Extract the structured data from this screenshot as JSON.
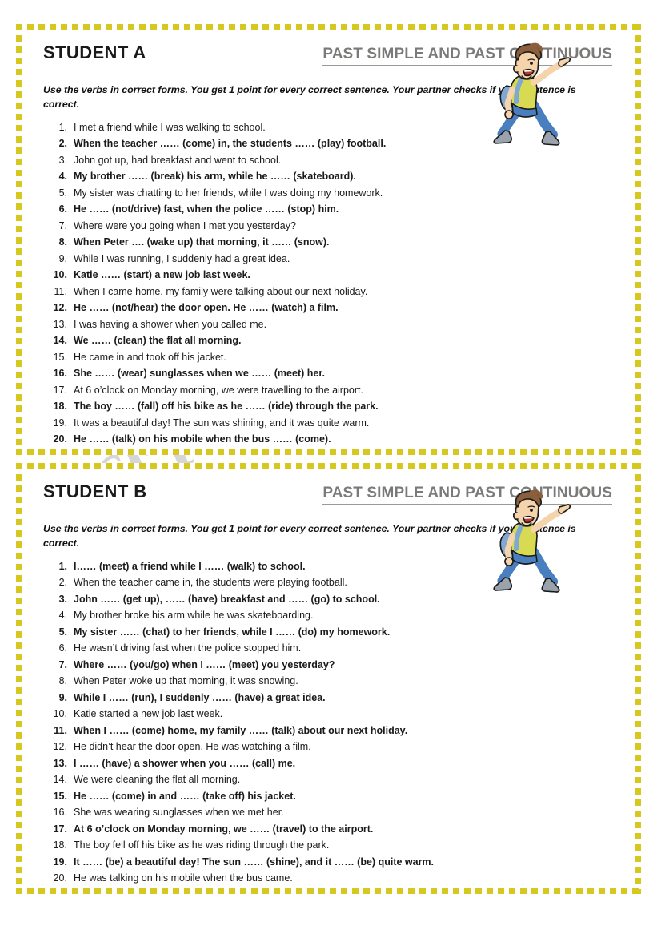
{
  "watermark": {
    "text": "esl-printables.com"
  },
  "colors": {
    "border_yellow": "#d6c81e",
    "title_gray": "#7a7a78",
    "text_black": "#1a1a1a",
    "shirt_yellow": "#d8db52",
    "jeans_blue": "#4a7fbf",
    "backpack_blue": "#7fa8d4",
    "hair_brown": "#8b5e3c",
    "skin": "#f5d3ab",
    "shoe_gray": "#9aa3ad"
  },
  "sections": [
    {
      "student_label": "STUDENT A",
      "topic_title": "PAST SIMPLE AND PAST CONTINUOUS",
      "instructions": "Use the verbs in correct forms.  You get 1 point for every correct sentence.  Your partner checks if your sentence is correct.",
      "illustration": "running-schoolboy",
      "sentences": [
        {
          "n": 1,
          "gap": false,
          "text": "I met a friend while I was walking to school."
        },
        {
          "n": 2,
          "gap": true,
          "text": "When the teacher …… (come) in, the students …… (play) football."
        },
        {
          "n": 3,
          "gap": false,
          "text": "John got up, had breakfast and went to school."
        },
        {
          "n": 4,
          "gap": true,
          "text": "My brother …… (break) his arm, while he …… (skateboard)."
        },
        {
          "n": 5,
          "gap": false,
          "text": "My sister was chatting to her friends, while I was doing my homework."
        },
        {
          "n": 6,
          "gap": true,
          "text": "He …… (not/drive) fast, when the police …… (stop) him."
        },
        {
          "n": 7,
          "gap": false,
          "text": "Where were you going when I met you yesterday?"
        },
        {
          "n": 8,
          "gap": true,
          "text": "When Peter …. (wake up) that morning, it …… (snow)."
        },
        {
          "n": 9,
          "gap": false,
          "text": "While I was running, I suddenly had a great idea."
        },
        {
          "n": 10,
          "gap": true,
          "text": "Katie …… (start) a new job last week."
        },
        {
          "n": 11,
          "gap": false,
          "text": "When I came home, my family were talking about our next holiday."
        },
        {
          "n": 12,
          "gap": true,
          "text": "He ……  (not/hear) the door open. He …… (watch) a film."
        },
        {
          "n": 13,
          "gap": false,
          "text": "I was having a shower when you called me."
        },
        {
          "n": 14,
          "gap": true,
          "text": "We …… (clean) the flat all morning."
        },
        {
          "n": 15,
          "gap": false,
          "text": "He came in and took off his jacket."
        },
        {
          "n": 16,
          "gap": true,
          "text": "She ……  (wear) sunglasses when we ……  (meet) her."
        },
        {
          "n": 17,
          "gap": false,
          "text": "At 6 o’clock on Monday morning, we were travelling to the airport."
        },
        {
          "n": 18,
          "gap": true,
          "text": "The boy ……  (fall) off his bike as he ……  (ride) through the park."
        },
        {
          "n": 19,
          "gap": false,
          "text": "It was a beautiful day! The sun was shining, and it was quite warm."
        },
        {
          "n": 20,
          "gap": true,
          "text": "He ……  (talk) on his mobile when the bus ……  (come)."
        }
      ]
    },
    {
      "student_label": "STUDENT B",
      "topic_title": "PAST SIMPLE AND PAST CONTINUOUS",
      "instructions": "Use the verbs in correct forms.  You get 1 point for every correct sentence.  Your partner checks if your sentence is correct.",
      "illustration": "running-schoolboy",
      "sentences": [
        {
          "n": 1,
          "gap": true,
          "text": "I…… (meet) a friend while I …… (walk) to school."
        },
        {
          "n": 2,
          "gap": false,
          "text": "When the teacher came in, the students were playing football."
        },
        {
          "n": 3,
          "gap": true,
          "text": "John …… (get up), …… (have) breakfast and …… (go) to school."
        },
        {
          "n": 4,
          "gap": false,
          "text": "My brother broke his arm while he was skateboarding."
        },
        {
          "n": 5,
          "gap": true,
          "text": "My sister …… (chat) to her friends, while I …… (do) my homework."
        },
        {
          "n": 6,
          "gap": false,
          "text": "He wasn’t driving fast when the police stopped him."
        },
        {
          "n": 7,
          "gap": true,
          "text": "Where …… (you/go) when I …… (meet) you yesterday?"
        },
        {
          "n": 8,
          "gap": false,
          "text": "When Peter woke up that morning, it was snowing."
        },
        {
          "n": 9,
          "gap": true,
          "text": "While I …… (run), I suddenly ……  (have) a great idea."
        },
        {
          "n": 10,
          "gap": false,
          "text": "Katie started a new job last week."
        },
        {
          "n": 11,
          "gap": true,
          "text": "When I …… (come) home, my family …… (talk) about our next holiday."
        },
        {
          "n": 12,
          "gap": false,
          "text": "He didn’t hear the door open. He was watching a film."
        },
        {
          "n": 13,
          "gap": true,
          "text": "I …… (have) a shower when you …… (call) me."
        },
        {
          "n": 14,
          "gap": false,
          "text": "We were cleaning the flat all morning."
        },
        {
          "n": 15,
          "gap": true,
          "text": "He ……  (come) in and ……  (take off) his jacket."
        },
        {
          "n": 16,
          "gap": false,
          "text": "She was wearing sunglasses when we met her."
        },
        {
          "n": 17,
          "gap": true,
          "text": "At 6 o’clock on Monday morning, we ……  (travel) to the airport."
        },
        {
          "n": 18,
          "gap": false,
          "text": "The boy fell off his bike as he was riding through the park."
        },
        {
          "n": 19,
          "gap": true,
          "text": "It ……  (be) a beautiful day! The sun ……  (shine), and it ……  (be) quite warm."
        },
        {
          "n": 20,
          "gap": false,
          "text": "He was talking on his mobile when the bus came."
        }
      ]
    }
  ]
}
